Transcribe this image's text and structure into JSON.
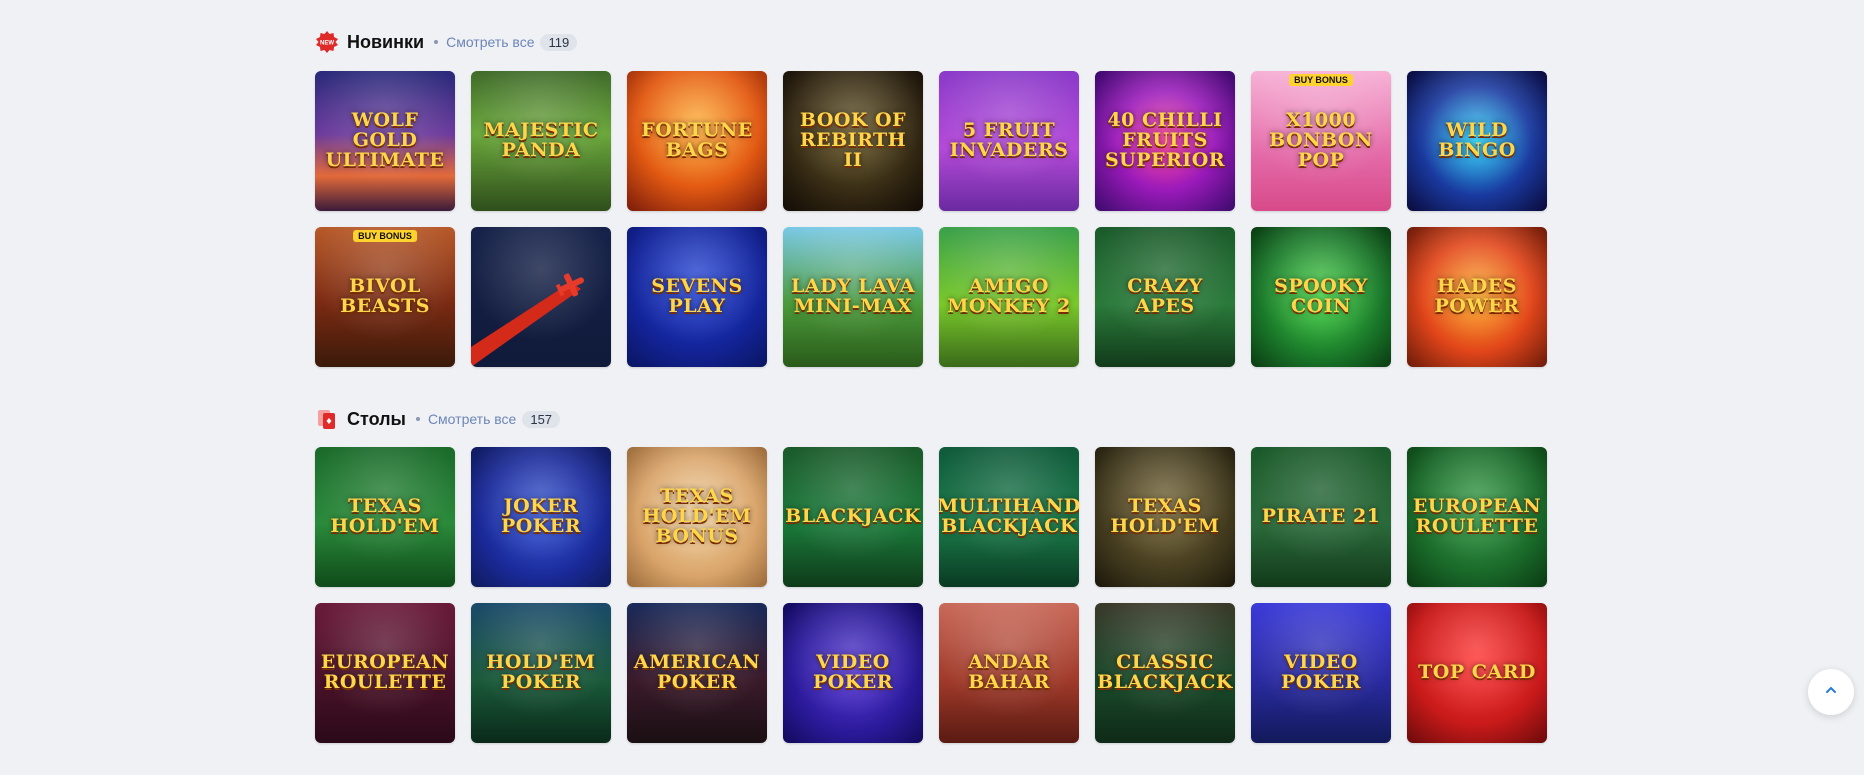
{
  "sections": {
    "new": {
      "title": "Новинки",
      "see_all": "Смотреть все",
      "count": "119",
      "icon": "new-badge-icon",
      "tiles": [
        {
          "title": "WOLF GOLD\nULTIMATE",
          "bg": "linear-gradient(180deg,#2a2a7a 0%,#6b3a9c 45%,#e26a3a 75%,#3a1a3a 100%)"
        },
        {
          "title": "MAJESTIC\nPANDA",
          "bg": "linear-gradient(180deg,#3f6b2a 0%,#6aa73a 45%,#2f4e1c 100%)"
        },
        {
          "title": "FORTUNE\nBAGS",
          "bg": "radial-gradient(circle at 50% 40%,#ffb13a 0%,#e35a12 55%,#7a1a0a 100%)"
        },
        {
          "title": "BOOK OF\nREBIRTH II",
          "bg": "radial-gradient(circle at 50% 45%,#6b5a2a 0%,#2a200f 70%,#120c06 100%)"
        },
        {
          "title": "5 FRUIT\nINVADERS",
          "bg": "linear-gradient(180deg,#8a3ac9 0%,#b44ad9 55%,#6a2aa0 100%)"
        },
        {
          "title": "40 CHILLI FRUITS\nSUPERIOR",
          "bg": "radial-gradient(circle at 50% 50%,#ff3a9a 0%,#9a1aba 50%,#3a0a6a 100%)"
        },
        {
          "title": "x1000\nBONBON POP",
          "bg": "linear-gradient(180deg,#f7b2d6 0%,#e46aa8 60%,#d84a8a 100%)",
          "badge": "BUY BONUS"
        },
        {
          "title": "WILD\nBINGO",
          "bg": "radial-gradient(circle at 50% 50%,#2ad6ff 0%,#1a3aa0 55%,#0a0a3a 100%)"
        },
        {
          "title": "BIVOL\nBEASTS",
          "bg": "linear-gradient(180deg,#b85a2a 0%,#7a2a12 55%,#3a1a0a 100%)",
          "badge": "BUY BONUS"
        },
        {
          "title": "",
          "bg": "linear-gradient(180deg,#16224a 0%,#101a3a 100%)",
          "plane": true
        },
        {
          "title": "SEVENS\nPLAY",
          "bg": "radial-gradient(circle at 50% 40%,#2a4ad9 0%,#13249a 60%,#0a1560 100%)"
        },
        {
          "title": "LADY LAVA\nMINI-MAX",
          "bg": "linear-gradient(180deg,#7ac9e6 0%,#4a9a3a 55%,#2a5a1a 100%)"
        },
        {
          "title": "AMIGO\nMONKEY 2",
          "bg": "linear-gradient(180deg,#3aa04a 0%,#7ac92a 55%,#3a6a1a 100%)"
        },
        {
          "title": "CRAZY\nAPES",
          "bg": "linear-gradient(180deg,#1a5a2a 0%,#2a7a3a 55%,#123a1a 100%)"
        },
        {
          "title": "SPOOKY\nCOIN",
          "bg": "radial-gradient(circle at 50% 50%,#4ad94a 0%,#1a7a2a 60%,#0a3a12 100%)"
        },
        {
          "title": "HADES\nPOWER",
          "bg": "radial-gradient(circle at 50% 50%,#ffb02a 0%,#e2461a 55%,#6a1a0a 100%)"
        }
      ]
    },
    "tables": {
      "title": "Столы",
      "see_all": "Смотреть все",
      "count": "157",
      "icon": "cards-icon",
      "tiles": [
        {
          "title": "TEXAS\nHOLD'EM",
          "bg": "linear-gradient(180deg,#1a6a2a 0%,#2a8a3a 55%,#0f4a1a 100%)"
        },
        {
          "title": "JOKER POKER",
          "bg": "radial-gradient(circle at 50% 50%,#3a5ad9 0%,#1a2a9a 60%,#0f1a5a 100%)"
        },
        {
          "title": "TEXAS\nHOLD'EM BONUS",
          "bg": "radial-gradient(circle at 50% 50%,#f4d6a6 0%,#d9a46a 60%,#9a6a3a 100%)"
        },
        {
          "title": "BLACKJACK",
          "bg": "linear-gradient(180deg,#1a5a2a 0%,#1a7a3a 55%,#0f3a1a 100%)"
        },
        {
          "title": "MULTIHAND\nBLACKJACK",
          "bg": "linear-gradient(180deg,#0f5a3a 0%,#1a7a4a 55%,#0a3a22 100%)"
        },
        {
          "title": "TEXAS\nHOLD'EM",
          "bg": "radial-gradient(circle at 50% 45%,#7a6a3a 0%,#3a331a 70%,#1a160a 100%)"
        },
        {
          "title": "PIRATE 21",
          "bg": "linear-gradient(180deg,#1a5a2a 0%,#2a6a3a 55%,#123a1a 100%)"
        },
        {
          "title": "EUROPEAN\nROULETTE",
          "bg": "radial-gradient(circle at 50% 45%,#3aa04a 0%,#1a6a2a 60%,#0a3a12 100%)"
        },
        {
          "title": "EUROPEAN\nROULETTE",
          "bg": "linear-gradient(180deg,#6a1a3a 0%,#4a1228 55%,#2a0a18 100%)"
        },
        {
          "title": "HOLD'EM\nPOKER",
          "bg": "linear-gradient(180deg,#1a4a6a 0%,#1a5a3a 55%,#0a2a1a 100%)"
        },
        {
          "title": "AMERICAN POKER",
          "bg": "linear-gradient(180deg,#1a2a5a 0%,#3a1a2a 55%,#1a0f12 100%)"
        },
        {
          "title": "VIDEO\nPOKER",
          "bg": "radial-gradient(circle at 50% 50%,#5a3ad9 0%,#2a1a9a 60%,#120a5a 100%)"
        },
        {
          "title": "ANDAR BAHAR",
          "bg": "linear-gradient(180deg,#c96a5a 0%,#a03a2a 55%,#5a1a12 100%)"
        },
        {
          "title": "CLASSIC\nBLACKJACK",
          "bg": "linear-gradient(180deg,#3a3a2a 0%,#1a4a2a 55%,#0f2a18 100%)"
        },
        {
          "title": "VIDEO POKER",
          "bg": "linear-gradient(180deg,#3a3ad9 0%,#2a2aa0 55%,#121a5a 100%)"
        },
        {
          "title": "TOP CARD",
          "bg": "radial-gradient(circle at 50% 40%,#ff3a3a 0%,#c91a1a 60%,#6a0a0a 100%)"
        }
      ]
    }
  },
  "scroll_top": {
    "icon": "chevron-up-icon"
  }
}
